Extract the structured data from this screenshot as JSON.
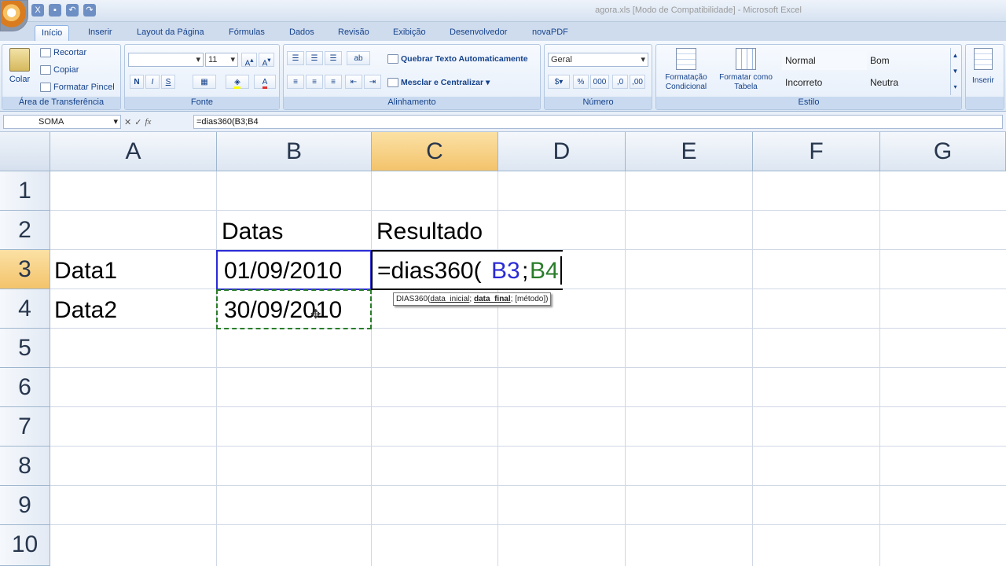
{
  "window": {
    "title": "agora.xls [Modo de Compatibilidade] - Microsoft Excel"
  },
  "tabs": [
    "Início",
    "Inserir",
    "Layout da Página",
    "Fórmulas",
    "Dados",
    "Revisão",
    "Exibição",
    "Desenvolvedor",
    "novaPDF"
  ],
  "ribbon": {
    "clipboard": {
      "label": "Área de Transferência",
      "paste": "Colar",
      "cut": "Recortar",
      "copy": "Copiar",
      "format_painter": "Formatar Pincel"
    },
    "font": {
      "label": "Fonte",
      "size": "11",
      "bold": "N",
      "italic": "I",
      "underline": "S"
    },
    "alignment": {
      "label": "Alinhamento",
      "wrap": "Quebrar Texto Automaticamente",
      "merge": "Mesclar e Centralizar"
    },
    "number": {
      "label": "Número",
      "format": "Geral",
      "percent": "%",
      "thousands": "000"
    },
    "styles": {
      "label": "Estilo",
      "cond_format": "Formatação Condicional",
      "format_table": "Formatar como Tabela",
      "normal": "Normal",
      "bom": "Bom",
      "incorreto": "Incorreto",
      "neutra": "Neutra"
    },
    "cells": {
      "insert": "Inserir"
    }
  },
  "formula_bar": {
    "name_box": "SOMA",
    "formula": "=dias360(B3;B4"
  },
  "columns": [
    "A",
    "B",
    "C",
    "D",
    "E",
    "F",
    "G"
  ],
  "rows": [
    "1",
    "2",
    "3",
    "4",
    "5",
    "6",
    "7",
    "8",
    "9",
    "10"
  ],
  "cells": {
    "B2": "Datas",
    "C2": "Resultado",
    "A3": "Data1",
    "B3": "01/09/2010",
    "A4": "Data2",
    "B4": "30/09/2010",
    "C3_prefix": "=dias360(",
    "C3_ref1": "B3",
    "C3_sep": ";",
    "C3_ref2": "B4"
  },
  "tooltip": {
    "fn": "DIAS360(",
    "arg1": "data_inicial",
    "sep1": "; ",
    "arg2": "data_final",
    "sep2": "; ",
    "arg3": "[método]",
    "close": ")"
  },
  "colors": {
    "ref1": "#2b2bd6",
    "ref2": "#2a7d2a",
    "selection": "#f3c36b"
  }
}
